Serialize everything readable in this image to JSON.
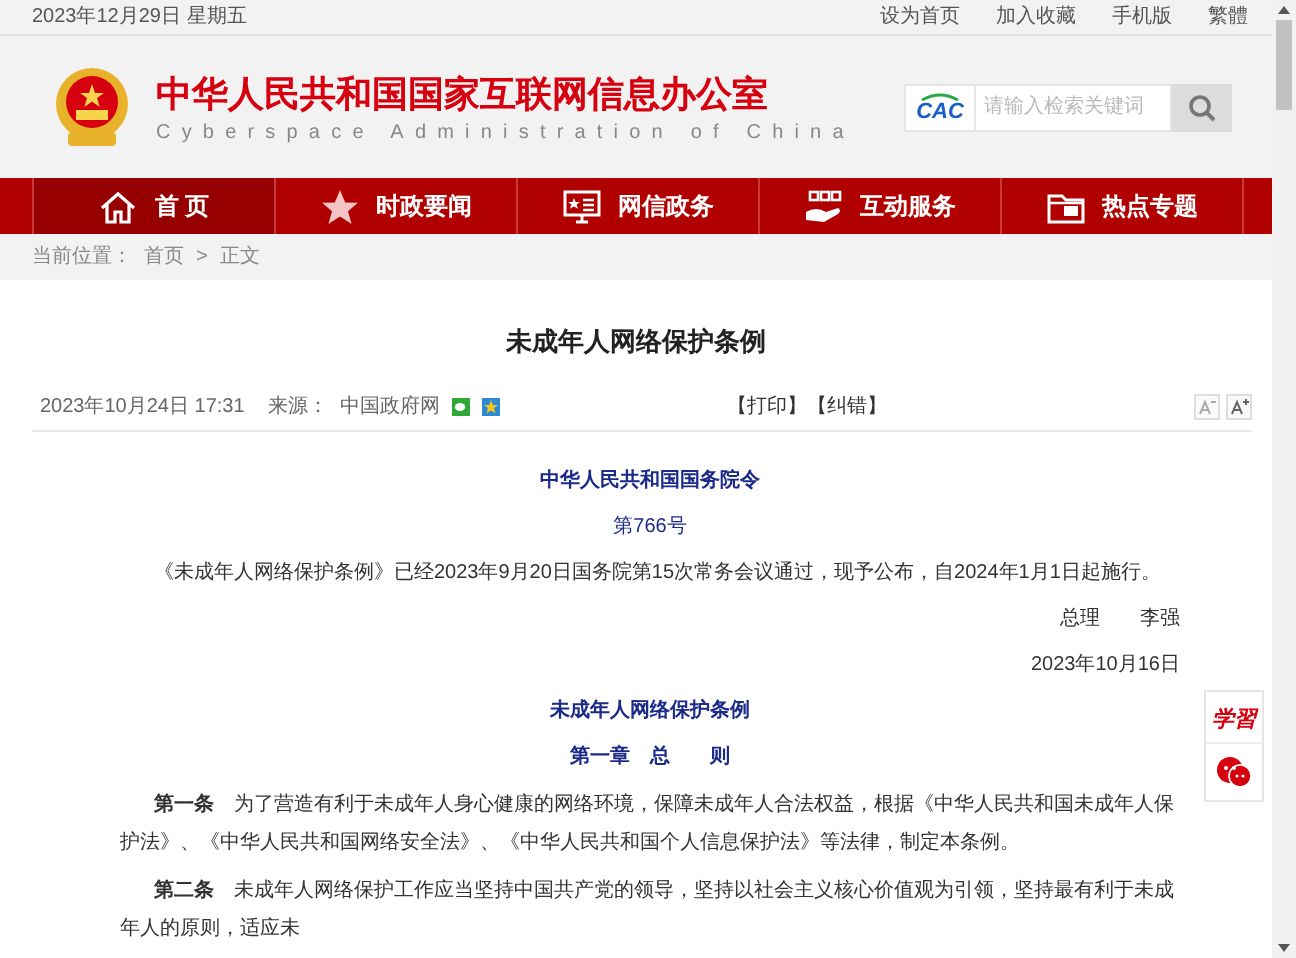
{
  "top_bar": {
    "date": "2023年12月29日 星期五",
    "links": [
      "设为首页",
      "加入收藏",
      "手机版",
      "繁體"
    ]
  },
  "header": {
    "title": "中华人民共和国国家互联网信息办公室",
    "subtitle": "Cyberspace Administration of China",
    "search": {
      "logo_text": "CAC",
      "placeholder": "请输入检索关键词"
    }
  },
  "nav": [
    {
      "label": "首 页",
      "selected": true
    },
    {
      "label": "时政要闻",
      "selected": false
    },
    {
      "label": "网信政务",
      "selected": false
    },
    {
      "label": "互动服务",
      "selected": false
    },
    {
      "label": "热点专题",
      "selected": false
    }
  ],
  "breadcrumb": {
    "label": "当前位置：",
    "items": [
      "首页",
      "正文"
    ],
    "separator": ">"
  },
  "article": {
    "title": "未成年人网络保护条例",
    "meta": {
      "date": "2023年10月24日 17:31",
      "source_label": "来源：",
      "source": "中国政府网",
      "actions": [
        "【打印】",
        "【纠错】"
      ]
    },
    "body": [
      {
        "kind": "heading",
        "text": "中华人民共和国国务院令"
      },
      {
        "kind": "number",
        "text": "第766号"
      },
      {
        "kind": "paragraph",
        "text": "《未成年人网络保护条例》已经2023年9月20日国务院第15次常务会议通过，现予公布，自2024年1月1日起施行。"
      },
      {
        "kind": "signature",
        "text": "总理　　李强"
      },
      {
        "kind": "date",
        "text": "2023年10月16日"
      },
      {
        "kind": "heading",
        "text": "未成年人网络保护条例"
      },
      {
        "kind": "heading",
        "text": "第一章　总　　则"
      },
      {
        "kind": "clause",
        "text": "**第一条**　为了营造有利于未成年人身心健康的网络环境，保障未成年人合法权益，根据《中华人民共和国未成年人保护法》、《中华人民共和国网络安全法》、《中华人民共和国个人信息保护法》等法律，制定本条例。"
      },
      {
        "kind": "clause",
        "text": "**第二条**　未成年人网络保护工作应当坚持中国共产党的领导，坚持以社会主义核心价值观为引领，坚持最有利于未成年人的原则，适应未"
      }
    ]
  },
  "side_widget": {
    "logo_text": "学習"
  }
}
